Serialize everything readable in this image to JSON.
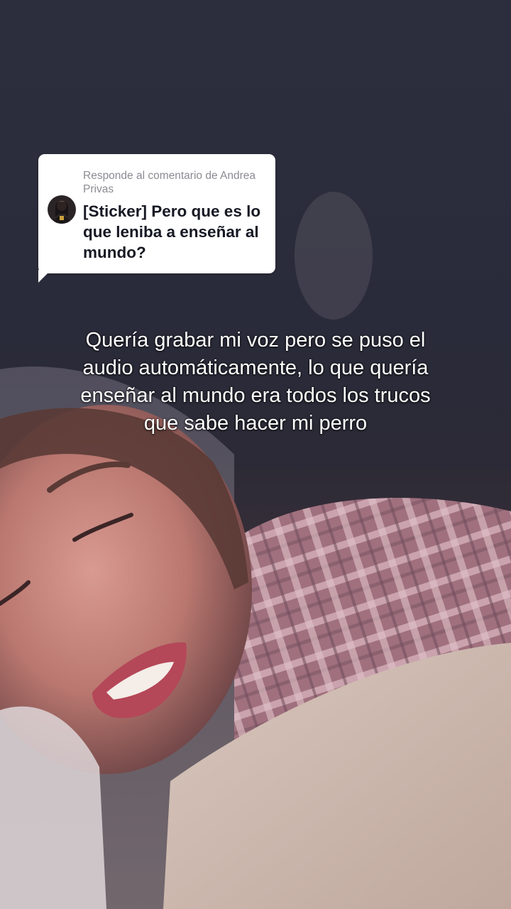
{
  "reply_card": {
    "header": "Responde al comentario de Andrea Privas",
    "comment": "[Sticker] Pero que es lo que leniba a enseñar al mundo?"
  },
  "caption": "Quería grabar mi voz pero se puso el audio automáticamente, lo que quería enseñar al mundo era todos los trucos que sabe hacer mi perro",
  "colors": {
    "card_background": "#ffffff",
    "card_header_text": "#8a8b91",
    "card_comment_text": "#161823",
    "caption_text": "#ffffff",
    "video_background": "#2c2e3e"
  }
}
